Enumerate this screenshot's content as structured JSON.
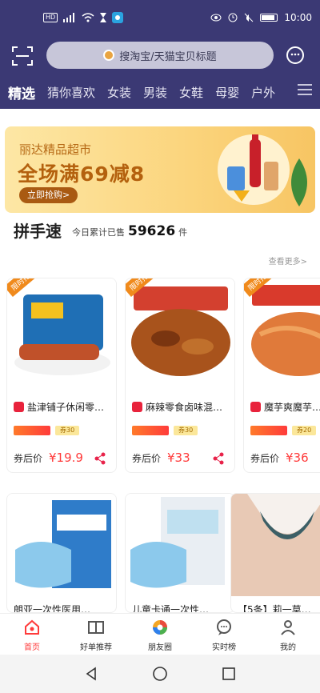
{
  "status_bar": {
    "time": "10:00",
    "sim_label": "HD"
  },
  "header": {
    "search_placeholder": "搜淘宝/天猫宝贝标题",
    "tabs": [
      {
        "label": "精选",
        "active": true
      },
      {
        "label": "猜你喜欢"
      },
      {
        "label": "女装"
      },
      {
        "label": "男装"
      },
      {
        "label": "女鞋"
      },
      {
        "label": "母婴"
      },
      {
        "label": "户外"
      }
    ]
  },
  "banner": {
    "subtitle": "丽达精品超市",
    "headline": "全场满69减8",
    "button": "立即抢购>"
  },
  "pin_section": {
    "title": "拼手速",
    "stat_prefix": "今日累计已售",
    "stat_count": "59626",
    "stat_unit": "件",
    "more": "查看更多>"
  },
  "products": [
    {
      "name": "盐津铺子休闲零…",
      "ribbon": "限时抢购",
      "coupon": "券30",
      "price_label": "券后价",
      "price": "¥19.9"
    },
    {
      "name": "麻辣零食卤味混…",
      "ribbon": "限时抢购",
      "coupon": "券30",
      "price_label": "券后价",
      "price": "¥33"
    },
    {
      "name": "魔芋爽魔芋…",
      "ribbon": "限时抢购",
      "coupon": "券20",
      "price_label": "券后价",
      "price": "¥36"
    }
  ],
  "products2": [
    {
      "name": "朗亚一次性医用…"
    },
    {
      "name": "儿童卡通一次性…"
    },
    {
      "name": "【5条】莉一莫…"
    }
  ],
  "bottom_nav": [
    {
      "label": "首页",
      "active": true
    },
    {
      "label": "好单推荐"
    },
    {
      "label": "朋友圈"
    },
    {
      "label": "实时榜"
    },
    {
      "label": "我的"
    }
  ]
}
